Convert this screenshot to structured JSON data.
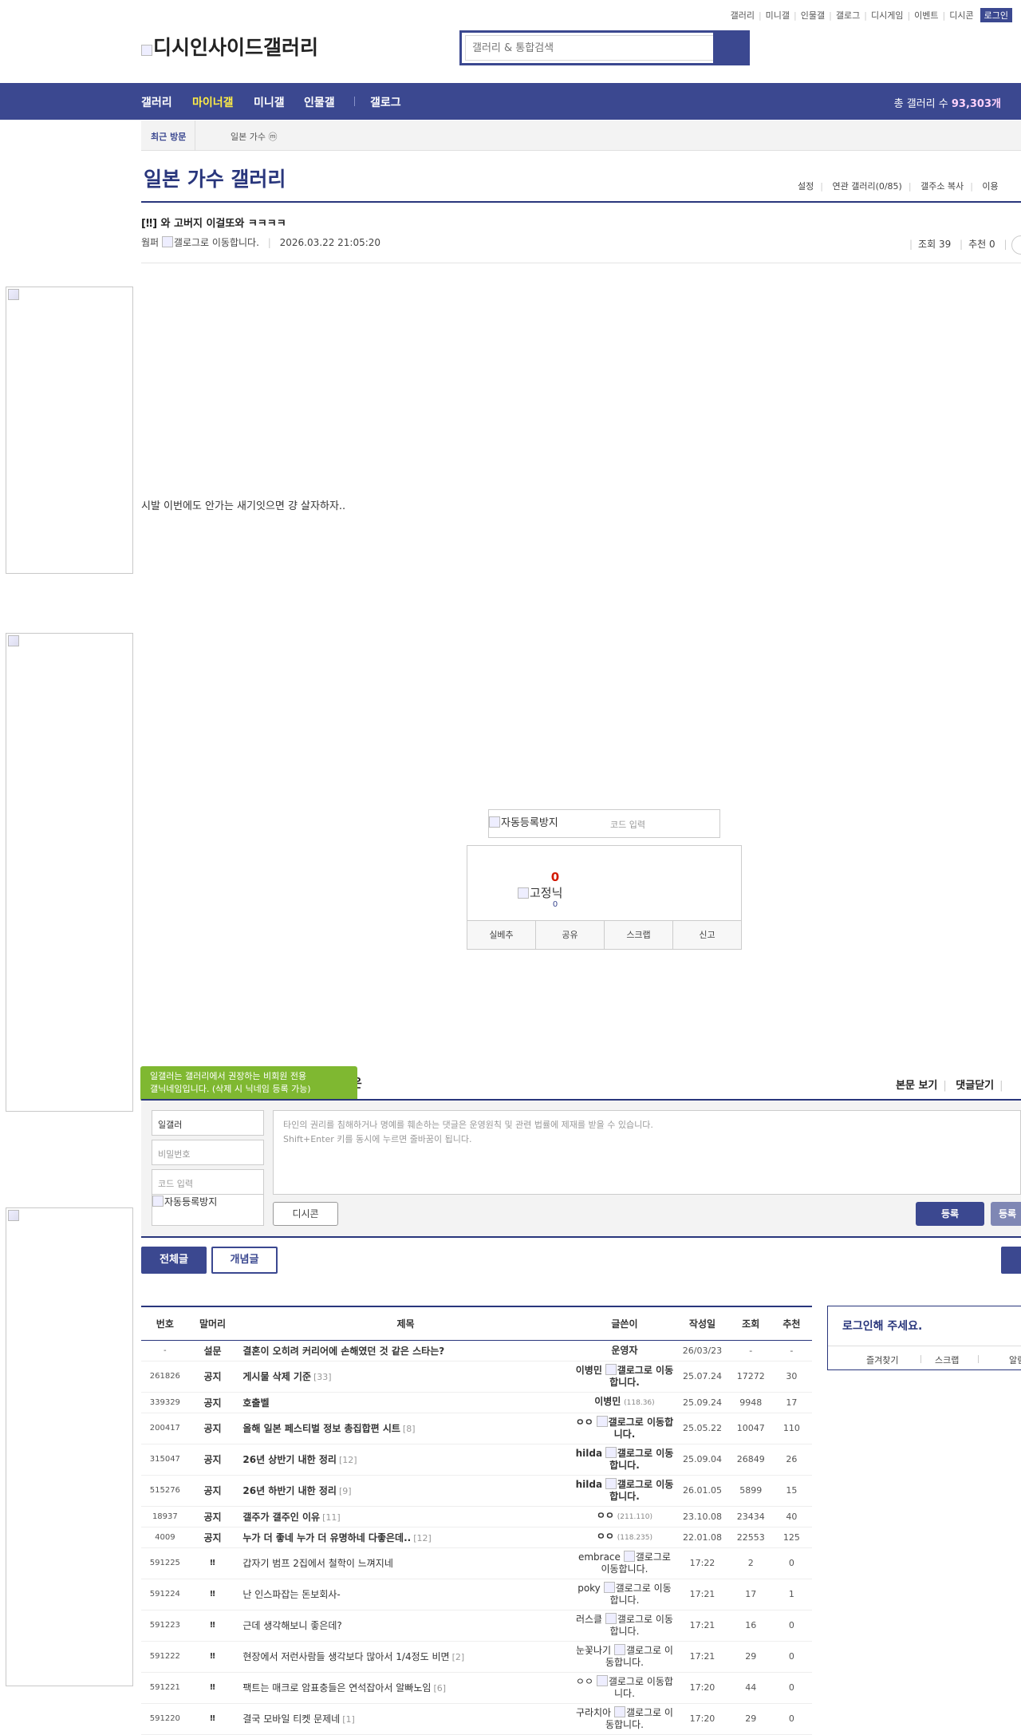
{
  "top_links": [
    "갤러리",
    "미니갤",
    "인물갤",
    "갤로그",
    "디시게임",
    "이벤트",
    "디시콘"
  ],
  "login_label": "로그인",
  "logo_alt": "디시인사이드갤러리",
  "search": {
    "placeholder": "갤러리 & 통합검색"
  },
  "nav": {
    "items": [
      "갤러리",
      "마이너갤",
      "미니갤",
      "인물갤",
      "갤로그"
    ],
    "active_color": "#ffed45",
    "total_label": "총 갤러리 수",
    "total_value": "93,303개"
  },
  "recent": {
    "label": "최근 방문",
    "gallery": "일본 가수 ⓜ"
  },
  "gallery": {
    "title": "일본 가수 갤러리",
    "menu": [
      "설정",
      "연관 갤러리(0/85)",
      "갤주소 복사",
      "이용"
    ]
  },
  "post": {
    "title": "[‼] 와 고버지 이걸또와 ㅋㅋㅋㅋ",
    "author": "웜퍼",
    "author_icon_alt": "갤로그로 이동합니다.",
    "date": "2026.03.22 21:05:20",
    "views_label": "조회 39",
    "recommends_label": "추천 0",
    "body": "시발 이번에도 안가는 새기잇으면 걍 살자하자.."
  },
  "captcha": {
    "alt": "자동등록방지",
    "placeholder": "코드 입력"
  },
  "recommend": {
    "count": "0",
    "fixed_nick_alt": "고정닉",
    "fixed_count": "0",
    "buttons": [
      "실베추",
      "공유",
      "스크랩",
      "신고"
    ]
  },
  "comment": {
    "tooltip_line1": "일갤러는 갤러리에서 권장하는 비회원 전용",
    "tooltip_line2": "갤닉네임입니다. (삭제 시 닉네임 등록 가능)",
    "header_cut": "은",
    "view_links": [
      "본문 보기",
      "댓글닫기"
    ],
    "nickname_value": "일갤러",
    "password_placeholder": "비밀번호",
    "code_placeholder": "코드 입력",
    "captcha_alt": "자동등록방지",
    "textarea_line1": "타인의 권리를 침해하거나 명예를 훼손하는 댓글은 운영원칙 및 관련 법률에 제재를 받을 수 있습니다.",
    "textarea_line2": "Shift+Enter 키를 동시에 누르면 줄바꿈이 됩니다.",
    "dccon_label": "디시콘",
    "submit_label": "등록",
    "submit2_label": "등록"
  },
  "list_tabs": [
    "전체글",
    "개념글"
  ],
  "table": {
    "headers": [
      "번호",
      "말머리",
      "제목",
      "글쓴이",
      "작성일",
      "조회",
      "추천"
    ],
    "rows": [
      {
        "num": "-",
        "head": "설문",
        "subject": "결혼이 오히려 커리어에 손해였던 것 같은 스타는?",
        "replies": "",
        "writer": "운영자",
        "writer_extra": "",
        "date": "26/03/23",
        "views": "-",
        "rec": "-"
      },
      {
        "num": "261826",
        "head": "공지",
        "subject": "게시물 삭제 기준",
        "replies": "[33]",
        "writer": "이병민",
        "writer_extra": "갤로그로 이동합니다.",
        "date": "25.07.24",
        "views": "17272",
        "rec": "30"
      },
      {
        "num": "339329",
        "head": "공지",
        "subject": "호출벨",
        "replies": "",
        "writer": "이병민",
        "writer_extra": "(118.36)",
        "date": "25.09.24",
        "views": "9948",
        "rec": "17"
      },
      {
        "num": "200417",
        "head": "공지",
        "subject": "올해 일본 페스티벌 정보 총집합편 시트",
        "replies": "[8]",
        "writer": "ㅇㅇ",
        "writer_extra": "갤로그로 이동합니다.",
        "date": "25.05.22",
        "views": "10047",
        "rec": "110"
      },
      {
        "num": "315047",
        "head": "공지",
        "subject": "26년 상반기 내한 정리",
        "replies": "[12]",
        "writer": "hilda",
        "writer_extra": "갤로그로 이동합니다.",
        "date": "25.09.04",
        "views": "26849",
        "rec": "26"
      },
      {
        "num": "515276",
        "head": "공지",
        "subject": "26년 하반기 내한 정리",
        "replies": "[9]",
        "writer": "hilda",
        "writer_extra": "갤로그로 이동합니다.",
        "date": "26.01.05",
        "views": "5899",
        "rec": "15"
      },
      {
        "num": "18937",
        "head": "공지",
        "subject": "갤주가 갤주인 이유",
        "replies": "[11]",
        "writer": "ㅇㅇ",
        "writer_extra": "(211.110)",
        "date": "23.10.08",
        "views": "23434",
        "rec": "40"
      },
      {
        "num": "4009",
        "head": "공지",
        "subject": "누가 더 좋네 누가 더 유명하네 다좋은데..",
        "replies": "[12]",
        "writer": "ㅇㅇ",
        "writer_extra": "(118.235)",
        "date": "22.01.08",
        "views": "22553",
        "rec": "125"
      },
      {
        "num": "591225",
        "head": "‼",
        "subject": "갑자기 범프 2집에서 철학이 느껴지네",
        "replies": "",
        "writer": "embrace",
        "writer_extra": "갤로그로 이동합니다.",
        "date": "17:22",
        "views": "2",
        "rec": "0"
      },
      {
        "num": "591224",
        "head": "‼",
        "subject": "난 인스파잡는 돈보회사-",
        "replies": "",
        "writer": "poky",
        "writer_extra": "갤로그로 이동합니다.",
        "date": "17:21",
        "views": "17",
        "rec": "1"
      },
      {
        "num": "591223",
        "head": "‼",
        "subject": "근데 생각해보니 좋은데?",
        "replies": "",
        "writer": "러스클",
        "writer_extra": "갤로그로 이동합니다.",
        "date": "17:21",
        "views": "16",
        "rec": "0"
      },
      {
        "num": "591222",
        "head": "‼",
        "subject": "현장에서 저런사람들 생각보다 많아서 1/4정도 비면",
        "replies": "[2]",
        "writer": "눈꽃나기",
        "writer_extra": "갤로그로 이동합니다.",
        "date": "17:21",
        "views": "29",
        "rec": "0"
      },
      {
        "num": "591221",
        "head": "‼",
        "subject": "팩트는 매크로 암표충들은 연석잡아서 알빠노임",
        "replies": "[6]",
        "writer": "ㅇㅇ",
        "writer_extra": "갤로그로 이동합니다.",
        "date": "17:20",
        "views": "44",
        "rec": "0"
      },
      {
        "num": "591220",
        "head": "‼",
        "subject": "결국 모바일 티켓 문제네",
        "replies": "[1]",
        "writer": "구라치아",
        "writer_extra": "갤로그로 이동합니다.",
        "date": "17:20",
        "views": "29",
        "rec": "0"
      }
    ]
  },
  "login_box": {
    "message": "로그인해 주세요.",
    "links": [
      "즐겨찾기",
      "스크랩",
      "알림"
    ]
  }
}
